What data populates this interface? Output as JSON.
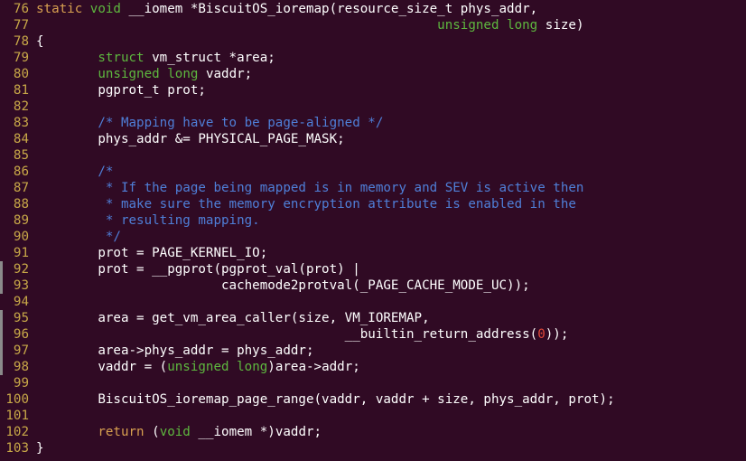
{
  "editor": {
    "colors": {
      "background": "#300a24",
      "line_number": "#c8a848",
      "keyword": "#d8a050",
      "type": "#5eb83f",
      "comment": "#4f7fd8",
      "number": "#e2493a",
      "text": "#ffffff",
      "change_marker": "#8a8a8a"
    },
    "lines": [
      {
        "num": "76",
        "marked": false,
        "segments": [
          [
            "kw",
            "static"
          ],
          [
            "pl",
            " "
          ],
          [
            "ty",
            "void"
          ],
          [
            "pl",
            " __iomem *BiscuitOS_ioremap(resource_size_t phys_addr,"
          ]
        ]
      },
      {
        "num": "77",
        "marked": false,
        "segments": [
          [
            "pl",
            "                                                    "
          ],
          [
            "ty",
            "unsigned"
          ],
          [
            "pl",
            " "
          ],
          [
            "ty",
            "long"
          ],
          [
            "pl",
            " size)"
          ]
        ]
      },
      {
        "num": "78",
        "marked": false,
        "segments": [
          [
            "pl",
            "{"
          ]
        ]
      },
      {
        "num": "79",
        "marked": false,
        "segments": [
          [
            "pl",
            "        "
          ],
          [
            "ty",
            "struct"
          ],
          [
            "pl",
            " vm_struct *area;"
          ]
        ]
      },
      {
        "num": "80",
        "marked": false,
        "segments": [
          [
            "pl",
            "        "
          ],
          [
            "ty",
            "unsigned"
          ],
          [
            "pl",
            " "
          ],
          [
            "ty",
            "long"
          ],
          [
            "pl",
            " vaddr;"
          ]
        ]
      },
      {
        "num": "81",
        "marked": false,
        "segments": [
          [
            "pl",
            "        pgprot_t prot;"
          ]
        ]
      },
      {
        "num": "82",
        "marked": false,
        "segments": []
      },
      {
        "num": "83",
        "marked": false,
        "segments": [
          [
            "pl",
            "        "
          ],
          [
            "cm",
            "/* Mapping have to be page-aligned */"
          ]
        ]
      },
      {
        "num": "84",
        "marked": false,
        "segments": [
          [
            "pl",
            "        phys_addr &= PHYSICAL_PAGE_MASK;"
          ]
        ]
      },
      {
        "num": "85",
        "marked": false,
        "segments": []
      },
      {
        "num": "86",
        "marked": false,
        "segments": [
          [
            "pl",
            "        "
          ],
          [
            "cm",
            "/*"
          ]
        ]
      },
      {
        "num": "87",
        "marked": false,
        "segments": [
          [
            "pl",
            "        "
          ],
          [
            "cm",
            " * If the page being mapped is in memory and SEV is active then"
          ]
        ]
      },
      {
        "num": "88",
        "marked": false,
        "segments": [
          [
            "pl",
            "        "
          ],
          [
            "cm",
            " * make sure the memory encryption attribute is enabled in the"
          ]
        ]
      },
      {
        "num": "89",
        "marked": false,
        "segments": [
          [
            "pl",
            "        "
          ],
          [
            "cm",
            " * resulting mapping."
          ]
        ]
      },
      {
        "num": "90",
        "marked": false,
        "segments": [
          [
            "pl",
            "        "
          ],
          [
            "cm",
            " */"
          ]
        ]
      },
      {
        "num": "91",
        "marked": false,
        "segments": [
          [
            "pl",
            "        prot = PAGE_KERNEL_IO;"
          ]
        ]
      },
      {
        "num": "92",
        "marked": true,
        "segments": [
          [
            "pl",
            "        prot = __pgprot(pgprot_val(prot) |"
          ]
        ]
      },
      {
        "num": "93",
        "marked": true,
        "segments": [
          [
            "pl",
            "                        cachemode2protval(_PAGE_CACHE_MODE_UC));"
          ]
        ]
      },
      {
        "num": "94",
        "marked": false,
        "segments": []
      },
      {
        "num": "95",
        "marked": true,
        "segments": [
          [
            "pl",
            "        area = get_vm_area_caller(size, VM_IOREMAP,"
          ]
        ]
      },
      {
        "num": "96",
        "marked": true,
        "segments": [
          [
            "pl",
            "                                        __builtin_return_address("
          ],
          [
            "num",
            "0"
          ],
          [
            "pl",
            "));"
          ]
        ]
      },
      {
        "num": "97",
        "marked": true,
        "segments": [
          [
            "pl",
            "        area->phys_addr = phys_addr;"
          ]
        ]
      },
      {
        "num": "98",
        "marked": true,
        "segments": [
          [
            "pl",
            "        vaddr = ("
          ],
          [
            "ty",
            "unsigned"
          ],
          [
            "pl",
            " "
          ],
          [
            "ty",
            "long"
          ],
          [
            "pl",
            ")area->addr;"
          ]
        ]
      },
      {
        "num": "99",
        "marked": false,
        "segments": []
      },
      {
        "num": "100",
        "marked": false,
        "segments": [
          [
            "pl",
            "        BiscuitOS_ioremap_page_range(vaddr, vaddr + size, phys_addr, prot);"
          ]
        ]
      },
      {
        "num": "101",
        "marked": false,
        "segments": []
      },
      {
        "num": "102",
        "marked": false,
        "segments": [
          [
            "pl",
            "        "
          ],
          [
            "kw",
            "return"
          ],
          [
            "pl",
            " ("
          ],
          [
            "ty",
            "void"
          ],
          [
            "pl",
            " __iomem *)vaddr;"
          ]
        ]
      },
      {
        "num": "103",
        "marked": false,
        "segments": [
          [
            "pl",
            "}"
          ]
        ]
      }
    ]
  }
}
